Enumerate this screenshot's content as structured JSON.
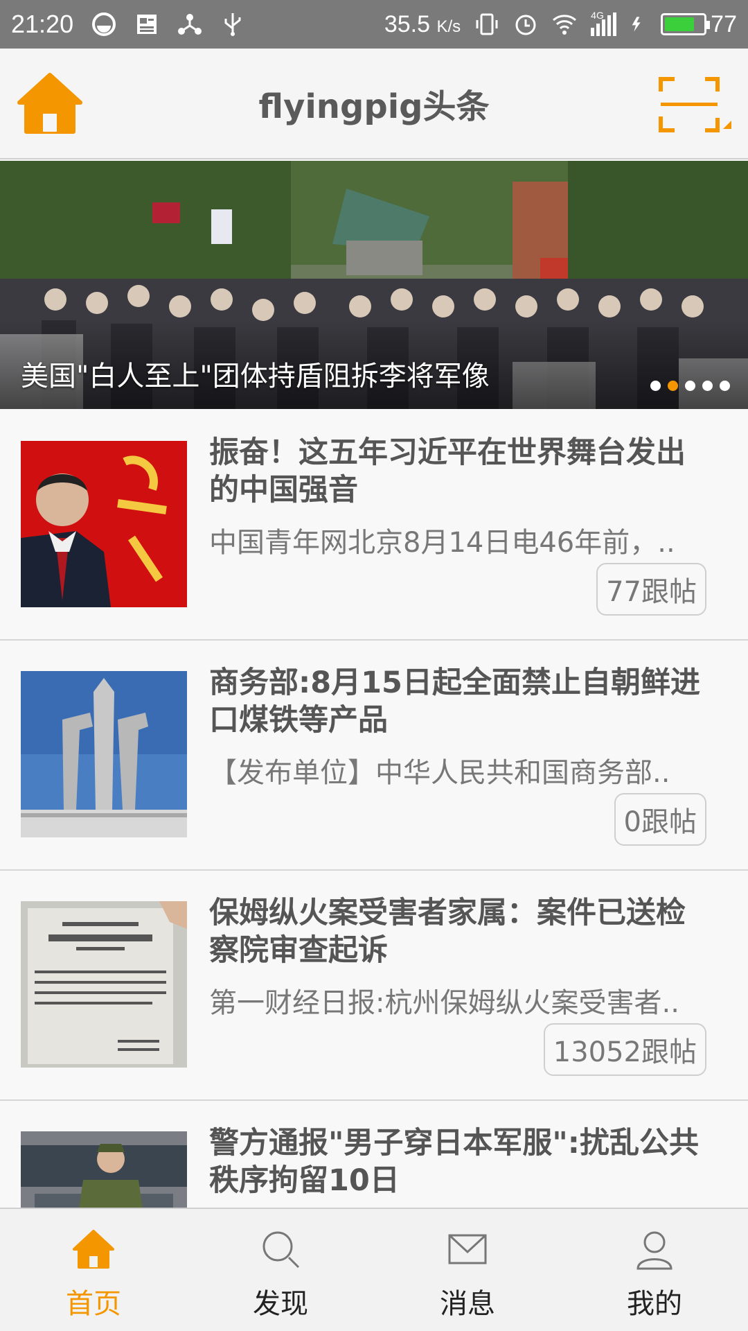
{
  "status_bar": {
    "time": "21:20",
    "net_speed": "35.5",
    "net_unit": "K/s",
    "network_type": "4G",
    "battery": "77"
  },
  "header": {
    "title": "flyingpig头条",
    "accent_color": "#f49600"
  },
  "banner": {
    "caption": "美国\"白人至上\"团体持盾阻拆李将军像",
    "dots": 5,
    "active_dot": 2
  },
  "news": [
    {
      "title": "振奋！这五年习近平在世界舞台发出的中国强音",
      "summary": "中国青年网北京8月14日电46年前，..",
      "replies": "77跟帖"
    },
    {
      "title": "商务部:8月15日起全面禁止自朝鲜进口煤铁等产品",
      "summary": "【发布单位】中华人民共和国商务部..",
      "replies": "0跟帖"
    },
    {
      "title": "保姆纵火案受害者家属：案件已送检察院审查起诉",
      "summary": "第一财经日报:杭州保姆纵火案受害者..",
      "replies": "13052跟帖"
    },
    {
      "title": "警方通报\"男子穿日本军服\":扰乱公共秩序拘留10日",
      "summary": "",
      "replies": ""
    }
  ],
  "bottom_nav": [
    {
      "label": "首页",
      "icon": "home-icon",
      "active": true
    },
    {
      "label": "发现",
      "icon": "search-icon",
      "active": false
    },
    {
      "label": "消息",
      "icon": "mail-icon",
      "active": false
    },
    {
      "label": "我的",
      "icon": "user-icon",
      "active": false
    }
  ]
}
